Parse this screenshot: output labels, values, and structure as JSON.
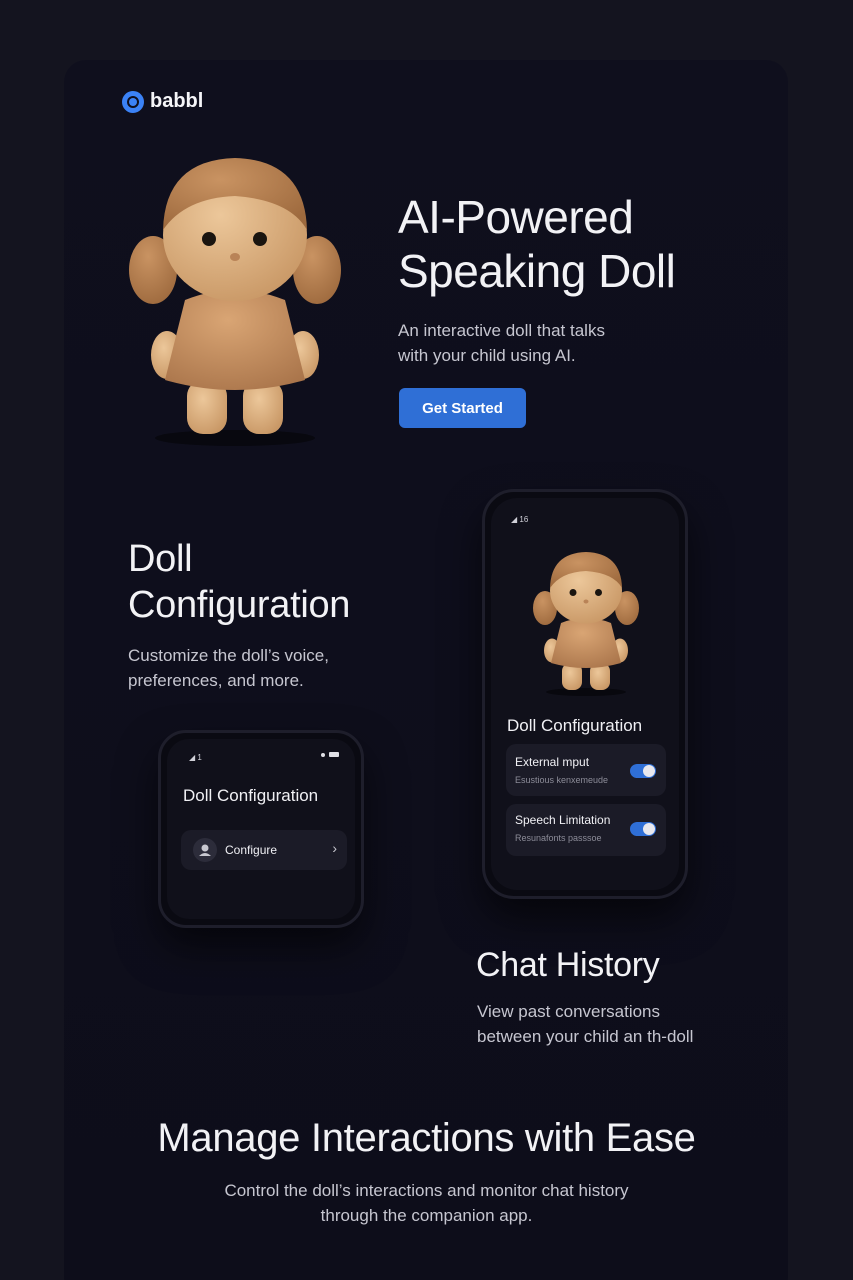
{
  "brand": {
    "name": "babbl",
    "accent": "#3b82f6"
  },
  "hero": {
    "title_line1": "AI-Powered",
    "title_line2": "Speaking Doll",
    "subtitle_line1": "An interactive doll that talks",
    "subtitle_line2": "with your child using AI.",
    "cta_label": "Get Started",
    "image": "doll-illustration"
  },
  "config_section": {
    "title_line1": "Doll",
    "title_line2": "Configuration",
    "subtitle_line1": "Customize the doll’s voice,",
    "subtitle_line2": "preferences, and more."
  },
  "small_phone": {
    "status_left": "◢ 1",
    "title": "Doll Configuration",
    "row_label": "Configure",
    "row_icon": "user-icon",
    "chevron": "›"
  },
  "large_phone": {
    "status_left": "◢ 16",
    "title": "Doll Configuration",
    "rows": [
      {
        "label": "External mput",
        "sub": "Esustious kenxemeude",
        "toggle_on": true
      },
      {
        "label": "Speech Limitation",
        "sub": "Resunafonts  passsoe",
        "toggle_on": true
      }
    ]
  },
  "chat_section": {
    "title": "Chat History",
    "subtitle_line1": "View past conversations",
    "subtitle_line2": "between your child an th-doll"
  },
  "bottom": {
    "title": "Manage Interactions with Ease",
    "subtitle_line1": "Control the doll’s interactions and monitor chat history",
    "subtitle_line2": "through the companion app."
  }
}
